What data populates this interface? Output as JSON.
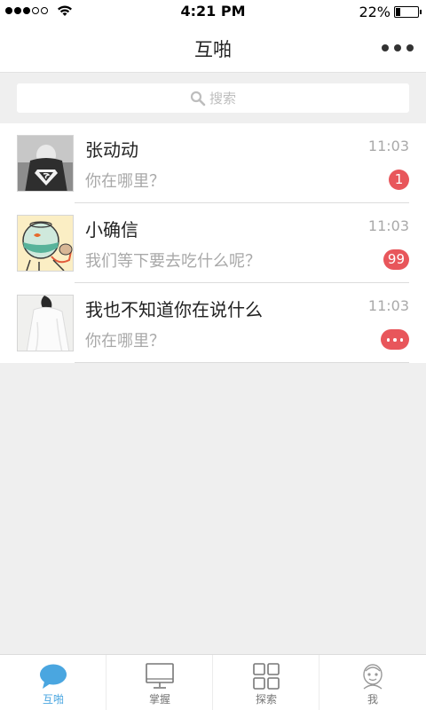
{
  "status_bar": {
    "time": "4:21 PM",
    "battery": "22%",
    "battery_level": 0.22,
    "signal_dots_filled": 3,
    "signal_dots_total": 5
  },
  "nav": {
    "title": "互啪",
    "more_icon": "more-dots-icon"
  },
  "search": {
    "placeholder": "搜索",
    "icon": "search-icon"
  },
  "chats": [
    {
      "name": "张动动",
      "time": "11:03",
      "preview": "你在哪里？",
      "badge": "1",
      "avatar": "superman-avatar"
    },
    {
      "name": "小确信",
      "time": "11:03",
      "preview": "我们等下要去吃什么呢？",
      "badge": "99",
      "avatar": "fishbowl-avatar"
    },
    {
      "name": "我也不知道你在说什么",
      "time": "11:03",
      "preview": "你在哪里？",
      "badge": "",
      "avatar": "person-avatar"
    }
  ],
  "tabs": [
    {
      "label": "互啪",
      "icon": "chat-bubble-icon",
      "active": true
    },
    {
      "label": "掌握",
      "icon": "monitor-icon",
      "active": false
    },
    {
      "label": "探索",
      "icon": "grid-icon",
      "active": false
    },
    {
      "label": "我",
      "icon": "profile-icon",
      "active": false
    }
  ],
  "colors": {
    "accent": "#4aa6e0",
    "badge": "#e8565b",
    "background": "#efefef"
  }
}
